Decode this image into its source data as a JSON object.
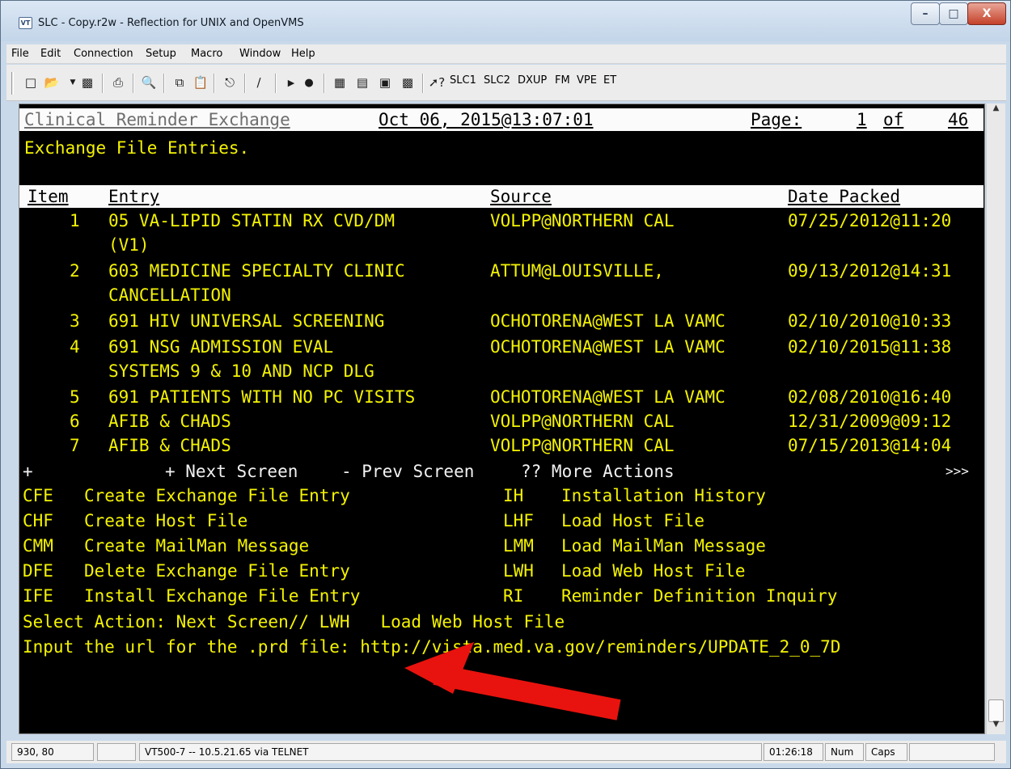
{
  "window": {
    "title": "SLC - Copy.r2w - Reflection for UNIX and OpenVMS",
    "icon_label": "VT",
    "min_label": "–",
    "max_label": "□",
    "close_label": "X"
  },
  "menu": [
    "File",
    "Edit",
    "Connection",
    "Setup",
    "Macro",
    "Window",
    "Help"
  ],
  "toolbar": {
    "buttons": [
      "new-icon",
      "open-icon",
      "save-icon",
      "print-icon",
      "find-icon",
      "copy-icon",
      "paste-icon",
      "connect-icon",
      "disconnect-icon",
      "play-icon",
      "record-icon",
      "settings-icon",
      "keyboard-icon",
      "display-icon",
      "color-icon",
      "help-icon"
    ],
    "macros": [
      "SLC1",
      "SLC2",
      "DXUP",
      "FM",
      "VPE",
      "ET"
    ]
  },
  "screen": {
    "header_title": "Clinical Reminder Exchange",
    "header_date": "Oct 06, 2015@13:07:01",
    "header_page_label": "Page:",
    "header_page": "1",
    "header_of": "of",
    "header_total": "46",
    "subtitle": "Exchange File Entries.",
    "columns": [
      "Item",
      "Entry",
      "Source",
      "Date Packed"
    ],
    "rows": [
      {
        "num": "1",
        "entry": "05 VA-LIPID STATIN RX CVD/DM",
        "source": "VOLPP@NORTHERN CAL",
        "date": "07/25/2012@11:20"
      },
      {
        "num": "",
        "entry": "(V1)",
        "source": "",
        "date": ""
      },
      {
        "num": "2",
        "entry": "603 MEDICINE SPECIALTY CLINIC",
        "source": "ATTUM@LOUISVILLE,",
        "date": "09/13/2012@14:31"
      },
      {
        "num": "",
        "entry": "CANCELLATION",
        "source": "",
        "date": ""
      },
      {
        "num": "3",
        "entry": "691 HIV UNIVERSAL SCREENING",
        "source": "OCHOTORENA@WEST LA VAMC",
        "date": "02/10/2010@10:33"
      },
      {
        "num": "4",
        "entry": "691 NSG ADMISSION EVAL",
        "source": "OCHOTORENA@WEST LA VAMC",
        "date": "02/10/2015@11:38"
      },
      {
        "num": "",
        "entry": "SYSTEMS 9 & 10 AND NCP DLG",
        "source": "",
        "date": ""
      },
      {
        "num": "5",
        "entry": "691 PATIENTS WITH NO PC VISITS",
        "source": "OCHOTORENA@WEST LA VAMC",
        "date": "02/08/2010@16:40"
      },
      {
        "num": "6",
        "entry": "AFIB & CHADS",
        "source": "VOLPP@NORTHERN CAL",
        "date": "12/31/2009@09:12"
      },
      {
        "num": "7",
        "entry": "AFIB & CHADS",
        "source": "VOLPP@NORTHERN CAL",
        "date": "07/15/2013@14:04"
      }
    ],
    "nav_plus": "+",
    "nav_next": "+ Next Screen",
    "nav_prev": "- Prev Screen",
    "nav_more": "?? More Actions",
    "nav_end": ">>>",
    "actions": [
      {
        "code": "CFE",
        "label": "Create Exchange File Entry",
        "code2": "IH",
        "label2": "Installation History"
      },
      {
        "code": "CHF",
        "label": "Create Host File",
        "code2": "LHF",
        "label2": "Load Host File"
      },
      {
        "code": "CMM",
        "label": "Create MailMan Message",
        "code2": "LMM",
        "label2": "Load MailMan Message"
      },
      {
        "code": "DFE",
        "label": "Delete Exchange File Entry",
        "code2": "LWH",
        "label2": "Load Web Host File"
      },
      {
        "code": "IFE",
        "label": "Install Exchange File Entry",
        "code2": "RI",
        "label2": "Reminder Definition Inquiry"
      }
    ],
    "prompt_select": "Select Action: Next Screen// LWH   Load Web Host File",
    "prompt_url": "Input the url for the .prd file: http://vista.med.va.gov/reminders/UPDATE_2_0_7D"
  },
  "status": {
    "cursor": "930, 80",
    "terminal": "VT500-7 -- 10.5.21.65 via TELNET",
    "time": "01:26:18",
    "num": "Num",
    "caps": "Caps"
  },
  "colors": {
    "terminal_bg": "#000000",
    "terminal_text": "#f4f300",
    "annotation": "#e8130e"
  }
}
